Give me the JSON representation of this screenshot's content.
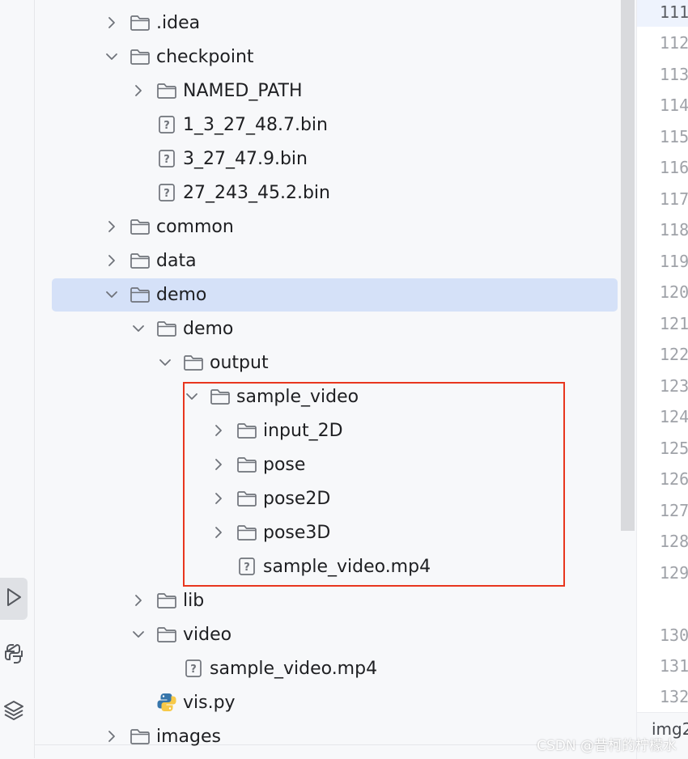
{
  "tree": {
    "rows": [
      {
        "label": ".idea",
        "icon": "folder",
        "chevron": "right"
      },
      {
        "label": "checkpoint",
        "icon": "folder",
        "chevron": "down"
      },
      {
        "label": "NAMED_PATH",
        "icon": "folder",
        "chevron": "right"
      },
      {
        "label": "1_3_27_48.7.bin",
        "icon": "unknown-file",
        "chevron": "none"
      },
      {
        "label": "3_27_47.9.bin",
        "icon": "unknown-file",
        "chevron": "none"
      },
      {
        "label": "27_243_45.2.bin",
        "icon": "unknown-file",
        "chevron": "none"
      },
      {
        "label": "common",
        "icon": "folder",
        "chevron": "right"
      },
      {
        "label": "data",
        "icon": "folder",
        "chevron": "right"
      },
      {
        "label": "demo",
        "icon": "folder",
        "chevron": "down",
        "selected": true
      },
      {
        "label": "demo",
        "icon": "folder",
        "chevron": "down"
      },
      {
        "label": "output",
        "icon": "folder",
        "chevron": "down"
      },
      {
        "label": "sample_video",
        "icon": "folder",
        "chevron": "down"
      },
      {
        "label": "input_2D",
        "icon": "folder",
        "chevron": "right"
      },
      {
        "label": "pose",
        "icon": "folder",
        "chevron": "right"
      },
      {
        "label": "pose2D",
        "icon": "folder",
        "chevron": "right"
      },
      {
        "label": "pose3D",
        "icon": "folder",
        "chevron": "right"
      },
      {
        "label": "sample_video.mp4",
        "icon": "unknown-file",
        "chevron": "none"
      },
      {
        "label": "lib",
        "icon": "folder",
        "chevron": "right"
      },
      {
        "label": "video",
        "icon": "folder",
        "chevron": "down"
      },
      {
        "label": "sample_video.mp4",
        "icon": "unknown-file",
        "chevron": "none"
      },
      {
        "label": "vis.py",
        "icon": "python-file",
        "chevron": "none"
      },
      {
        "label": "images",
        "icon": "folder",
        "chevron": "right"
      }
    ]
  },
  "editor": {
    "line_numbers": [
      "111",
      "112",
      "113",
      "114",
      "115",
      "116",
      "117",
      "118",
      "119",
      "120",
      "121",
      "122",
      "123",
      "124",
      "125",
      "126",
      "127",
      "128",
      "129",
      "130",
      "131",
      "132"
    ],
    "tab_label": "img2"
  },
  "toolwindow": {
    "buttons": [
      {
        "name": "run-icon",
        "active": true
      },
      {
        "name": "python-console-icon",
        "active": false
      },
      {
        "name": "layers-icon",
        "active": false
      }
    ]
  },
  "watermark": "CSDN @昔柯的柠檬水",
  "colors": {
    "selection": "#d5e1f8",
    "highlight_border": "#e8361e",
    "python_blue": "#3776ab",
    "python_yellow": "#f7c948"
  }
}
